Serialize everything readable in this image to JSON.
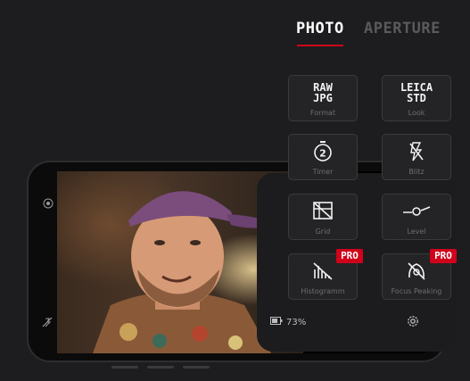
{
  "tabs": {
    "photo": "PHOTO",
    "aperture": "APERTURE"
  },
  "tiles": {
    "format": {
      "line1": "RAW",
      "line2": "JPG",
      "label": "Format"
    },
    "look": {
      "line1": "LEICA",
      "line2": "STD",
      "label": "Look"
    },
    "timer": {
      "value": "2",
      "label": "Timer",
      "icon": "timer-icon"
    },
    "blitz": {
      "label": "Blitz",
      "icon": "flash-off-icon"
    },
    "grid": {
      "label": "Grid",
      "icon": "grid-icon"
    },
    "level": {
      "label": "Level",
      "icon": "level-icon"
    },
    "histogramm": {
      "label": "Histogramm",
      "icon": "histogram-icon",
      "badge": "PRO"
    },
    "focus_peaking": {
      "label": "Focus Peaking",
      "icon": "focus-peaking-icon",
      "badge": "PRO"
    }
  },
  "status": {
    "battery": "73%"
  },
  "colors": {
    "accent": "#d0021b",
    "panel": "#1c1c1e",
    "tile_border": "#3b3b3d"
  }
}
